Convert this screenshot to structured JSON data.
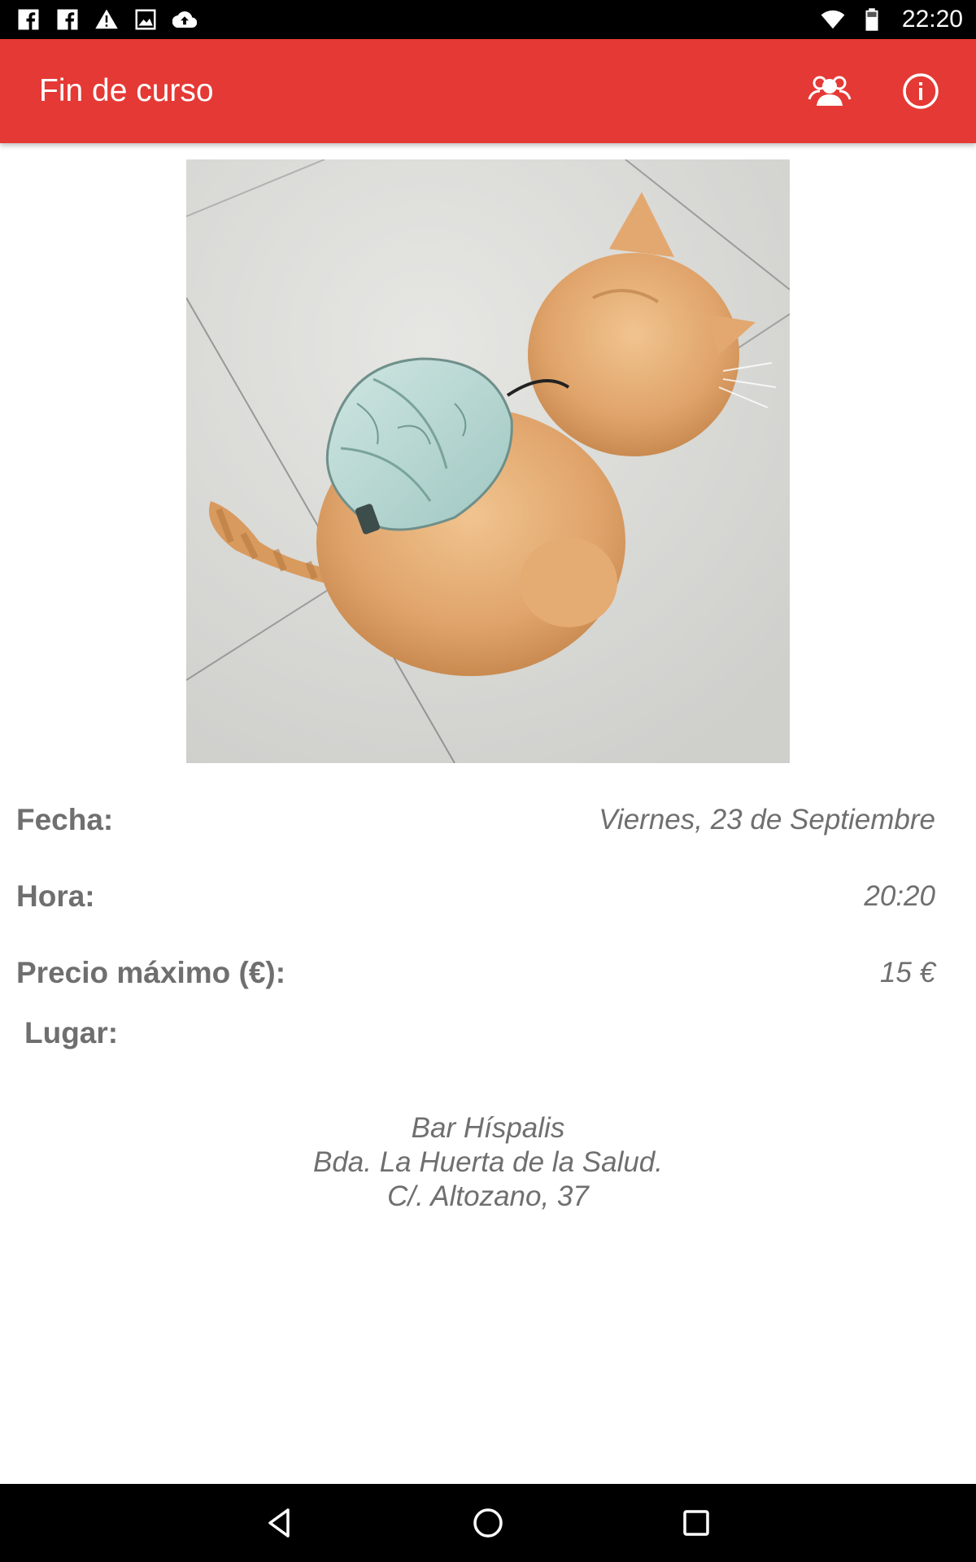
{
  "status_bar": {
    "time": "22:20",
    "left_icons": [
      "facebook-icon",
      "facebook-icon",
      "warning-icon",
      "image-icon",
      "cloud-upload-icon"
    ],
    "right_icons": [
      "wifi-icon",
      "battery-icon"
    ]
  },
  "app_bar": {
    "title": "Fin de curso",
    "actions": [
      "group-icon",
      "info-icon"
    ],
    "color": "#e53935"
  },
  "event": {
    "image": "cat-with-map-backpack",
    "details": [
      {
        "label": "Fecha:",
        "value": "Viernes, 23 de Septiembre"
      },
      {
        "label": "Hora:",
        "value": "20:20"
      },
      {
        "label": "Precio máximo (€):",
        "value": "15 €"
      }
    ],
    "place_label": "Lugar:",
    "place_lines": [
      "Bar Híspalis",
      "Bda. La Huerta de la Salud.",
      "C/. Altozano, 37"
    ]
  },
  "nav_bar": {
    "buttons": [
      "back-icon",
      "home-icon",
      "recent-apps-icon"
    ]
  }
}
